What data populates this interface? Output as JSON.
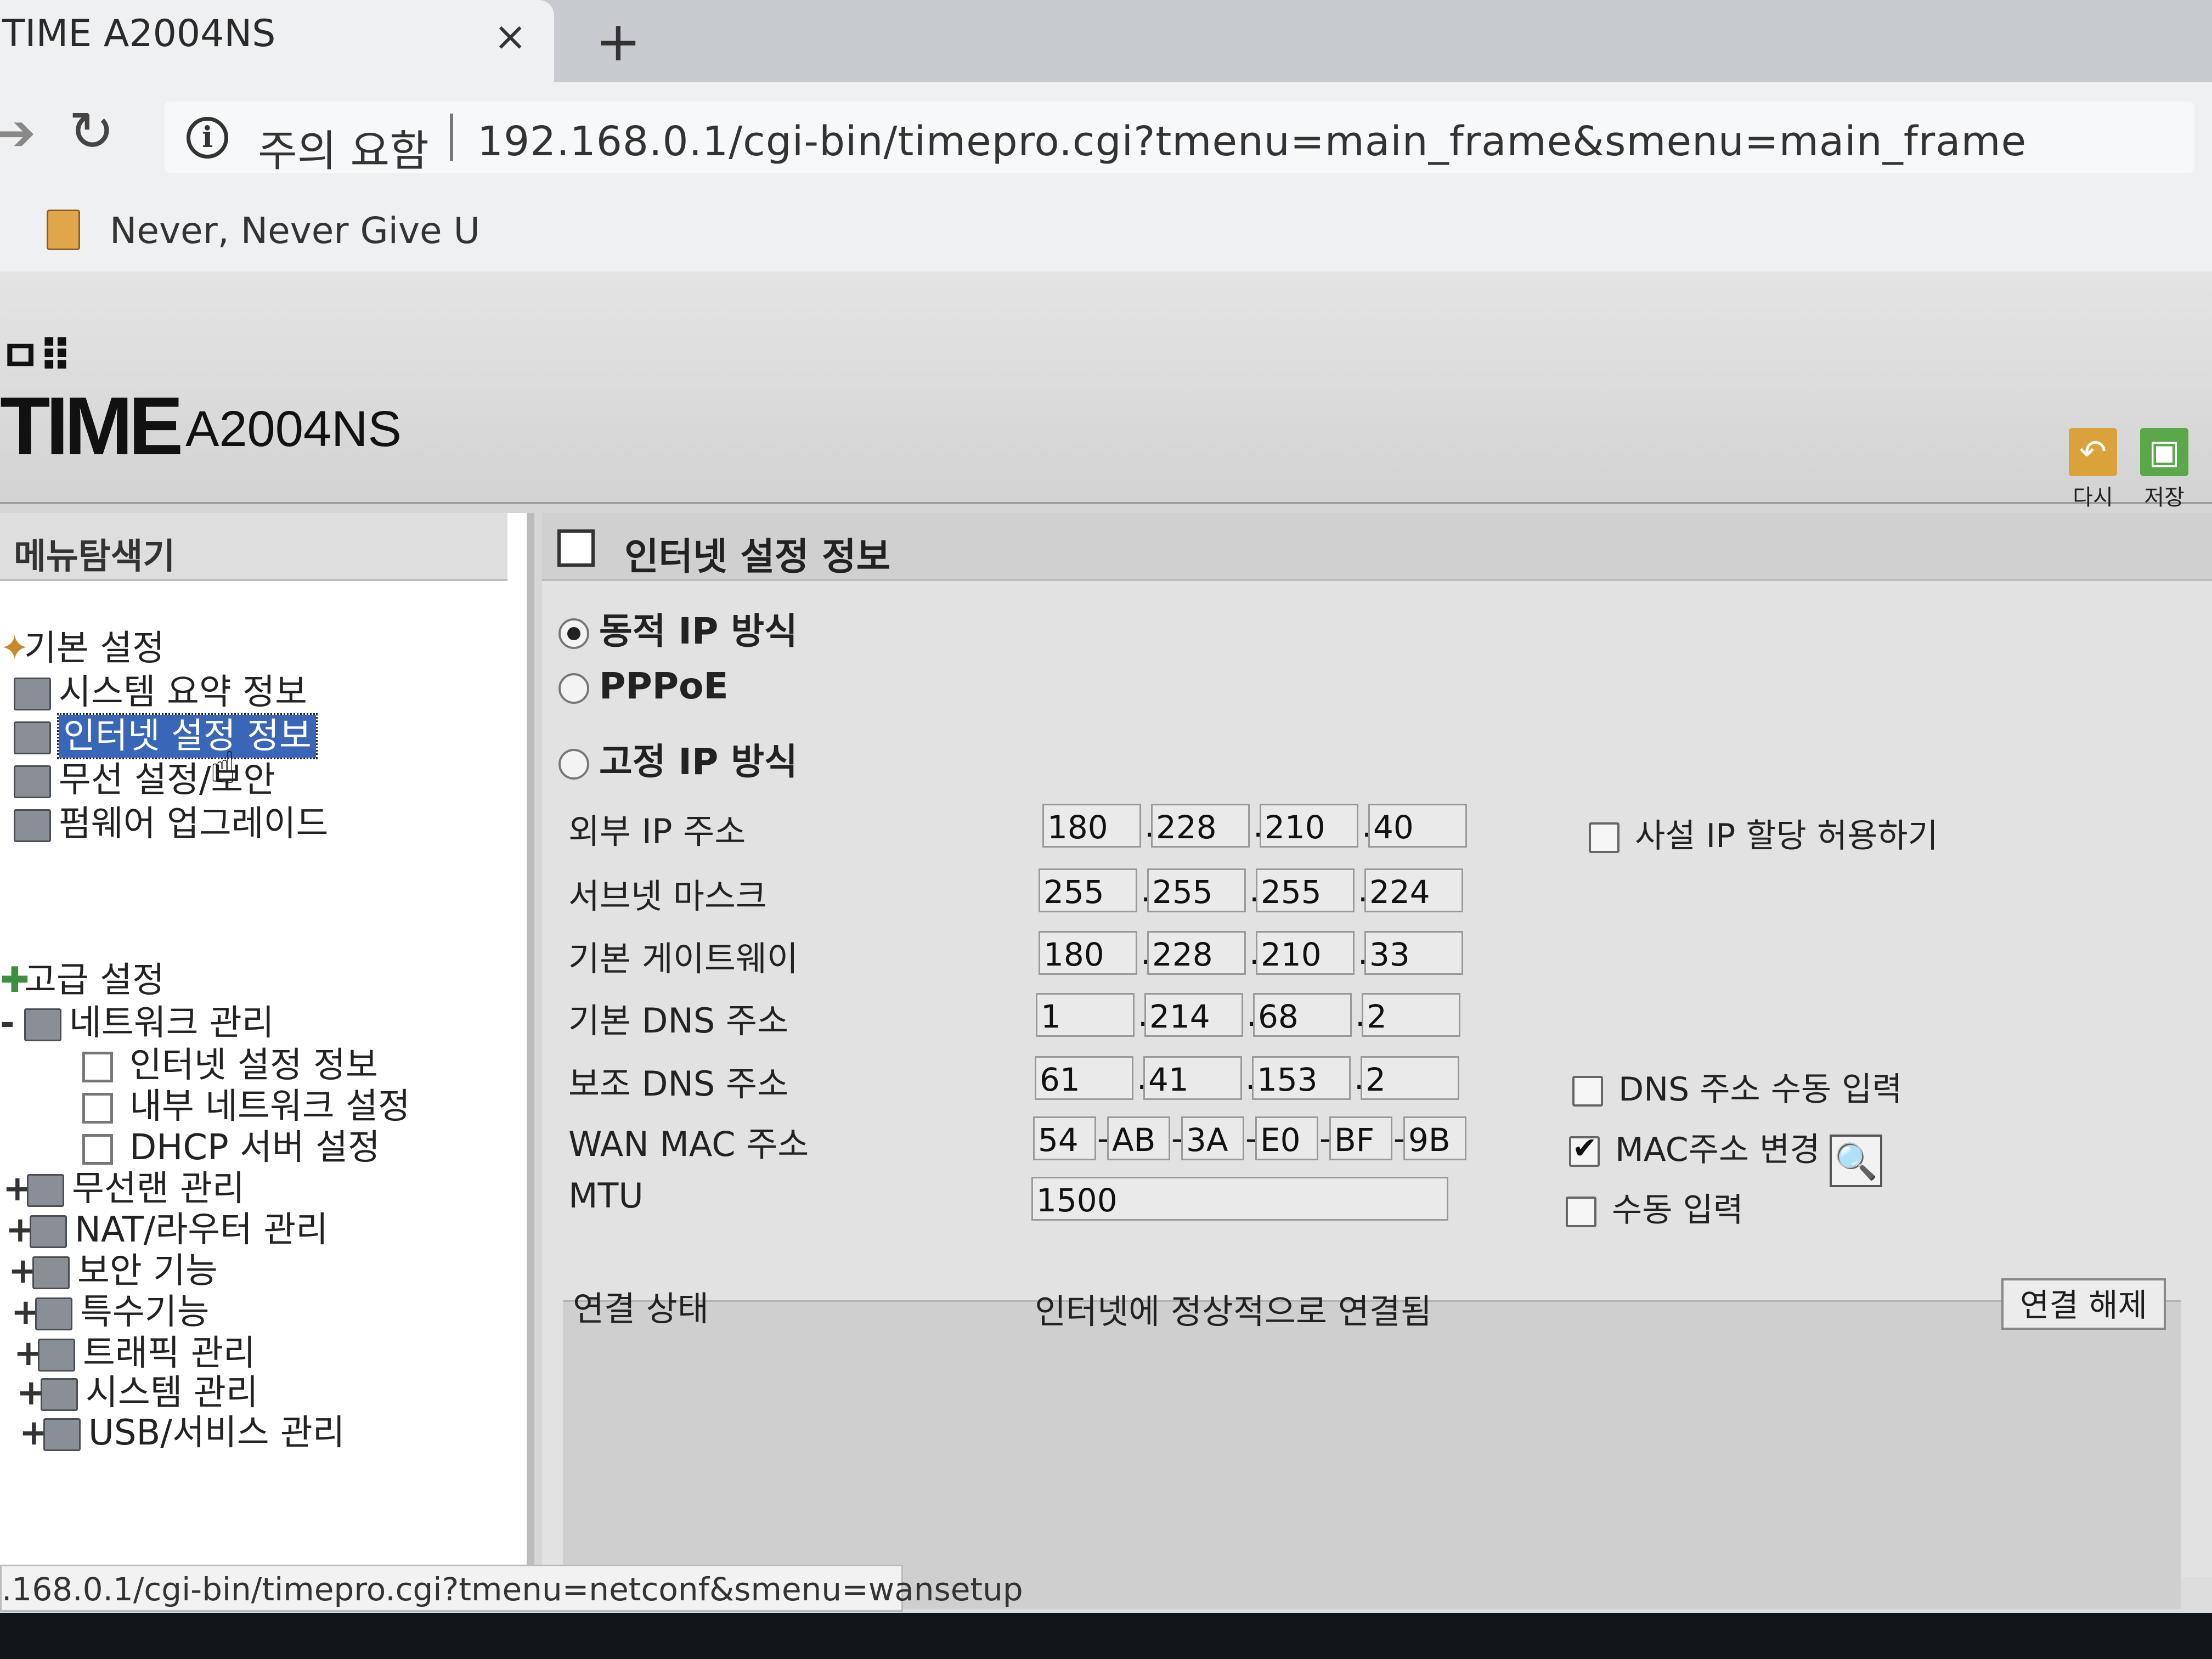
{
  "browser": {
    "tab_title": "TIME A2004NS",
    "tab_close": "×",
    "new_tab": "+",
    "security_text": "주의 요함",
    "url": "192.168.0.1/cgi-bin/timepro.cgi?tmenu=main_frame&smenu=main_frame",
    "bookmark": "Never, Never Give U",
    "status_url": ".168.0.1/cgi-bin/timepro.cgi?tmenu=netconf&smenu=wansetup"
  },
  "header": {
    "brand": "TIME",
    "model": "A2004NS",
    "retry_label": "다시",
    "save_label": "저장"
  },
  "sidebar": {
    "title": "메뉴탐색기",
    "basic": {
      "label": "기본 설정",
      "items": [
        "시스템 요약 정보",
        "인터넷 설정 정보",
        "무선 설정/보안",
        "펌웨어 업그레이드"
      ]
    },
    "advanced": {
      "label": "고급 설정",
      "network": {
        "label": "네트워크 관리",
        "items": [
          "인터넷 설정 정보",
          "내부 네트워크 설정",
          "DHCP 서버 설정"
        ]
      },
      "groups": [
        "무선랜 관리",
        "NAT/라우터 관리",
        "보안 기능",
        "특수기능",
        "트래픽 관리",
        "시스템 관리",
        "USB/서비스 관리"
      ]
    }
  },
  "content": {
    "title": "인터넷 설정 정보",
    "modes": [
      "동적 IP 방식",
      "PPPoE",
      "고정 IP 방식"
    ],
    "selected_mode": "동적 IP 방식",
    "fields": {
      "external_ip": {
        "label": "외부 IP 주소",
        "octets": [
          "180",
          "228",
          "210",
          "40"
        ]
      },
      "subnet_mask": {
        "label": "서브넷 마스크",
        "octets": [
          "255",
          "255",
          "255",
          "224"
        ]
      },
      "gateway": {
        "label": "기본 게이트웨이",
        "octets": [
          "180",
          "228",
          "210",
          "33"
        ]
      },
      "dns_primary": {
        "label": "기본 DNS 주소",
        "octets": [
          "1",
          "214",
          "68",
          "2"
        ]
      },
      "dns_secondary": {
        "label": "보조 DNS 주소",
        "octets": [
          "61",
          "41",
          "153",
          "2"
        ]
      },
      "wan_mac": {
        "label": "WAN MAC 주소",
        "parts": [
          "54",
          "AB",
          "3A",
          "E0",
          "BF",
          "9B"
        ]
      },
      "mtu": {
        "label": "MTU",
        "value": "1500"
      }
    },
    "options": {
      "private_ip": {
        "label": "사설 IP 할당 허용하기",
        "checked": false
      },
      "dns_manual": {
        "label": "DNS 주소 수동 입력",
        "checked": false
      },
      "mac_change": {
        "label": "MAC주소 변경",
        "checked": true
      },
      "manual_input": {
        "label": "수동 입력",
        "checked": false
      }
    },
    "connection": {
      "label": "연결 상태",
      "value": "인터넷에 정상적으로 연결됨",
      "button": "연결 해제"
    }
  },
  "icons": {
    "retry": "undo-icon",
    "save": "floppy-icon",
    "search": "magnifier-icon"
  }
}
